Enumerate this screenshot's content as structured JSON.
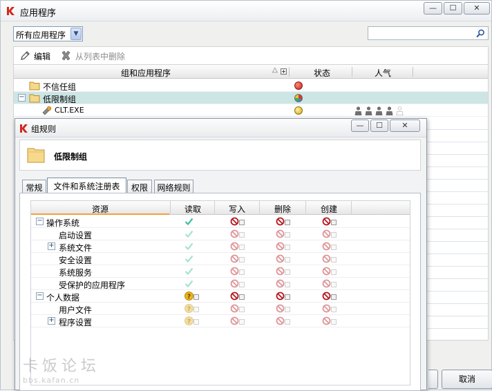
{
  "window": {
    "title": "应用程序",
    "minimize": "—",
    "maximize": "☐",
    "close": "✕"
  },
  "filter": {
    "selected": "所有应用程序"
  },
  "search": {
    "value": "",
    "placeholder": ""
  },
  "toolbar": {
    "edit_label": "编辑",
    "remove_label": "从列表中删除"
  },
  "app_table": {
    "columns": {
      "group_app": "组和应用程序",
      "sort": "△",
      "status": "状态",
      "popularity": "人气"
    },
    "rows": [
      {
        "label": "不信任组",
        "status_color": "#d43a2c"
      },
      {
        "label": "低限制组",
        "status_color": "multi"
      },
      {
        "label": "CLT.EXE",
        "status_color": "#e1c23a",
        "popularity": 4,
        "popularity_max": 5
      }
    ]
  },
  "dialog": {
    "title": "组规则",
    "minimize": "—",
    "maximize": "☐",
    "close": "✕",
    "header_title": "低限制组",
    "tabs": [
      "常规",
      "文件和系统注册表",
      "权限",
      "网络规则"
    ],
    "active_tab": 1,
    "columns": {
      "resource": "资源",
      "read": "读取",
      "write": "写入",
      "delete": "删除",
      "create": "创建"
    },
    "rows": [
      {
        "label": "操作系统",
        "expand": "−",
        "read": "allow",
        "write": "deny",
        "delete": "deny",
        "create": "deny",
        "inherited": false
      },
      {
        "label": "启动设置",
        "read": "allow",
        "write": "deny",
        "delete": "deny",
        "create": "deny",
        "inherited": true
      },
      {
        "label": "系统文件",
        "expand": "+",
        "read": "allow",
        "write": "deny",
        "delete": "deny",
        "create": "deny",
        "inherited": true
      },
      {
        "label": "安全设置",
        "read": "allow",
        "write": "deny",
        "delete": "deny",
        "create": "deny",
        "inherited": true
      },
      {
        "label": "系统服务",
        "read": "allow",
        "write": "deny",
        "delete": "deny",
        "create": "deny",
        "inherited": true
      },
      {
        "label": "受保护的应用程序",
        "read": "allow",
        "write": "deny",
        "delete": "deny",
        "create": "deny",
        "inherited": true
      },
      {
        "label": "个人数据",
        "expand": "−",
        "read": "ask",
        "write": "deny",
        "delete": "deny",
        "create": "deny",
        "inherited": false
      },
      {
        "label": "用户文件",
        "read": "ask",
        "write": "deny",
        "delete": "deny",
        "create": "deny",
        "inherited": true
      },
      {
        "label": "程序设置",
        "expand": "+",
        "read": "ask",
        "write": "deny",
        "delete": "deny",
        "create": "deny",
        "inherited": true
      }
    ]
  },
  "buttons": {
    "cancel": "取消"
  },
  "watermark": {
    "line1": "卡饭论坛",
    "line2": "bbs.kafan.cn"
  },
  "colors": {
    "accent": "#f4a03c",
    "allow": "#3bbf9d",
    "deny": "#b5161b",
    "ask": "#e9b51e",
    "selected_row": "#cde6e5"
  }
}
